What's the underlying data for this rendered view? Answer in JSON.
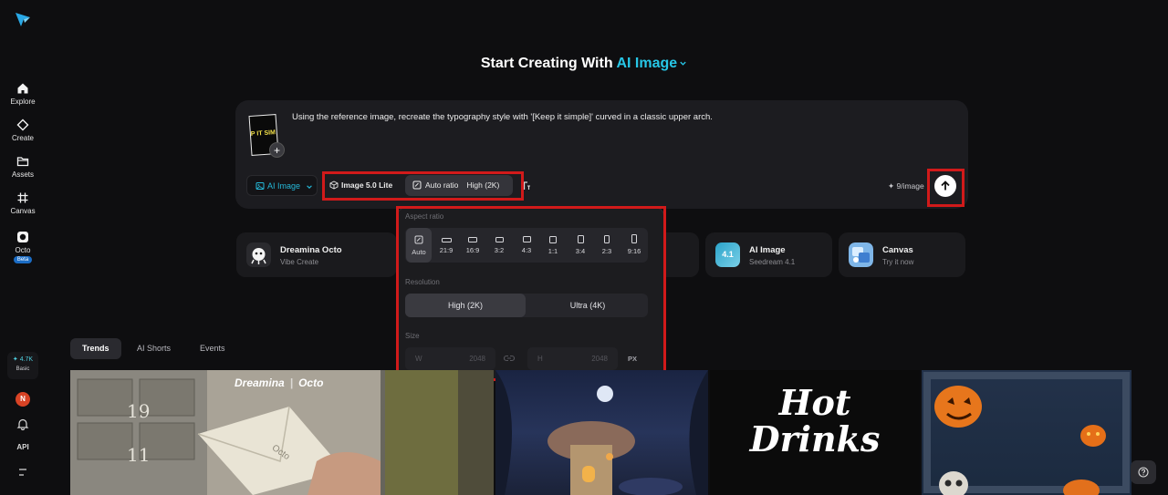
{
  "heading": {
    "prefix": "Start Creating With",
    "accent": "AI Image"
  },
  "sidebar": {
    "items": [
      {
        "label": "Explore"
      },
      {
        "label": "Create"
      },
      {
        "label": "Assets"
      },
      {
        "label": "Canvas"
      },
      {
        "label": "Octo",
        "badge": "Beta"
      }
    ],
    "credits": {
      "amount": "✦ 4.7K",
      "tier": "Basic"
    },
    "avatar_initial": "N",
    "api_label": "API"
  },
  "prompt": {
    "text": "Using the reference image, recreate the typography style with '[Keep it simple]' curved in a classic upper arch.",
    "thumb_text": "P IT SIM",
    "mode_label": "AI Image",
    "model_label": "Image 5.0 Lite",
    "ratio_label": "Auto ratio",
    "resolution_label": "High (2K)",
    "cost_label": "✦ 9/image"
  },
  "cards": [
    {
      "title": "Dreamina Octo",
      "subtitle": "Vibe Create"
    },
    {
      "title": "AI Image",
      "subtitle": "Seedream 4.1",
      "icon_text": "4.1"
    },
    {
      "title": "Canvas",
      "subtitle": "Try it now"
    }
  ],
  "popover": {
    "aspect_label": "Aspect ratio",
    "ratios": [
      "Auto",
      "21:9",
      "16:9",
      "3:2",
      "4:3",
      "1:1",
      "3:4",
      "2:3",
      "9:16"
    ],
    "selected_ratio": "Auto",
    "resolution_label": "Resolution",
    "resolutions": [
      "High (2K)",
      "Ultra (4K)"
    ],
    "selected_resolution": "High (2K)",
    "size_label": "Size",
    "width_letter": "W",
    "width_value": "2048",
    "height_letter": "H",
    "height_value": "2048",
    "unit": "PX"
  },
  "tabs": [
    "Trends",
    "AI Shorts",
    "Events"
  ],
  "active_tab": "Trends",
  "gallery": {
    "watermark": "Dreamina",
    "watermark_sub": "Octo",
    "letter_text": "Octo",
    "mailbox_numbers": [
      "19",
      "11"
    ],
    "hot_drinks_line1": "Hot",
    "hot_drinks_line2": "Drinks"
  },
  "colors": {
    "accent": "#27c6e6",
    "highlight": "#d11a1a",
    "panel": "#1c1c20",
    "background": "#0e0e10"
  }
}
